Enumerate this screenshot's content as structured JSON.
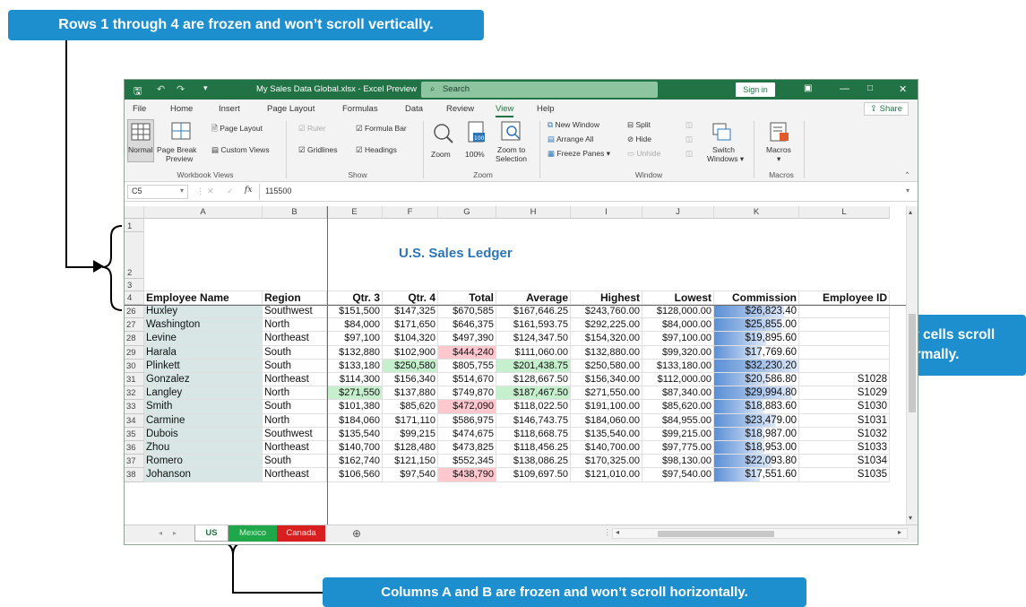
{
  "callouts": {
    "top": "Rows 1 through 4 are frozen and won’t scroll vertically.",
    "right_line1": "All other cells scroll",
    "right_line2": "normally.",
    "bottom": "Columns A and B are frozen and won’t scroll horizontally."
  },
  "titlebar": {
    "filename": "My Sales Data Global.xlsx  -  Excel Preview",
    "search_placeholder": "Search",
    "sign_in": "Sign in"
  },
  "menu": {
    "tabs": [
      "File",
      "Home",
      "Insert",
      "Page Layout",
      "Formulas",
      "Data",
      "Review",
      "View",
      "Help"
    ],
    "active": "View",
    "share": "Share"
  },
  "ribbon": {
    "workbook_views": {
      "label": "Workbook Views",
      "normal": "Normal",
      "page_break_1": "Page Break",
      "page_break_2": "Preview",
      "page_layout": "Page Layout",
      "custom_views": "Custom Views"
    },
    "show": {
      "label": "Show",
      "ruler": "Ruler",
      "formula_bar": "Formula Bar",
      "gridlines": "Gridlines",
      "headings": "Headings"
    },
    "zoom": {
      "label": "Zoom",
      "zoom": "Zoom",
      "hundred": "100%",
      "zoom_to_1": "Zoom to",
      "zoom_to_2": "Selection",
      "icon_100": "100"
    },
    "window": {
      "label": "Window",
      "new_window": "New Window",
      "arrange_all": "Arrange All",
      "freeze_panes": "Freeze Panes",
      "split": "Split",
      "hide": "Hide",
      "unhide": "Unhide",
      "switch_1": "Switch",
      "switch_2": "Windows"
    },
    "macros": {
      "label": "Macros",
      "macros": "Macros"
    }
  },
  "formula_bar": {
    "name_box": "C5",
    "fx": "fx",
    "value": "115500"
  },
  "columns": [
    "A",
    "B",
    "E",
    "F",
    "G",
    "H",
    "I",
    "J",
    "K",
    "L"
  ],
  "row_headers_frozen": [
    "1",
    "2",
    "3",
    "4"
  ],
  "title": "U.S. Sales Ledger",
  "headers": [
    "Employee Name",
    "Region",
    "Qtr. 3",
    "Qtr. 4",
    "Total",
    "Average",
    "Highest",
    "Lowest",
    "Commission",
    "Employee ID"
  ],
  "rows": [
    {
      "r": "26",
      "name": "Huxley",
      "region": "Southwest",
      "q3": "$151,500",
      "q4": "$147,325",
      "total": "$670,585",
      "avg": "$167,646.25",
      "high": "$243,760.00",
      "low": "$128,000.00",
      "comm": "$26,823.40",
      "id": ""
    },
    {
      "r": "27",
      "name": "Washington",
      "region": "North",
      "q3": "$84,000",
      "q4": "$171,650",
      "total": "$646,375",
      "avg": "$161,593.75",
      "high": "$292,225.00",
      "low": "$84,000.00",
      "comm": "$25,855.00",
      "id": ""
    },
    {
      "r": "28",
      "name": "Levine",
      "region": "Northeast",
      "q3": "$97,100",
      "q4": "$104,320",
      "total": "$497,390",
      "avg": "$124,347.50",
      "high": "$154,320.00",
      "low": "$97,100.00",
      "comm": "$19,895.60",
      "id": ""
    },
    {
      "r": "29",
      "name": "Harala",
      "region": "South",
      "q3": "$132,880",
      "q4": "$102,900",
      "total": "$444,240",
      "avg": "$111,060.00",
      "high": "$132,880.00",
      "low": "$99,320.00",
      "comm": "$17,769.60",
      "id": ""
    },
    {
      "r": "30",
      "name": "Plinkett",
      "region": "South",
      "q3": "$133,180",
      "q4": "$250,580",
      "total": "$805,755",
      "avg": "$201,438.75",
      "high": "$250,580.00",
      "low": "$133,180.00",
      "comm": "$32,230.20",
      "id": ""
    },
    {
      "r": "31",
      "name": "Gonzalez",
      "region": "Northeast",
      "q3": "$114,300",
      "q4": "$156,340",
      "total": "$514,670",
      "avg": "$128,667.50",
      "high": "$156,340.00",
      "low": "$112,000.00",
      "comm": "$20,586.80",
      "id": "S1028"
    },
    {
      "r": "32",
      "name": "Langley",
      "region": "North",
      "q3": "$271,550",
      "q4": "$137,880",
      "total": "$749,870",
      "avg": "$187,467.50",
      "high": "$271,550.00",
      "low": "$87,340.00",
      "comm": "$29,994.80",
      "id": "S1029"
    },
    {
      "r": "33",
      "name": "Smith",
      "region": "South",
      "q3": "$101,380",
      "q4": "$85,620",
      "total": "$472,090",
      "avg": "$118,022.50",
      "high": "$191,100.00",
      "low": "$85,620.00",
      "comm": "$18,883.60",
      "id": "S1030"
    },
    {
      "r": "34",
      "name": "Carmine",
      "region": "North",
      "q3": "$184,060",
      "q4": "$171,110",
      "total": "$586,975",
      "avg": "$146,743.75",
      "high": "$184,060.00",
      "low": "$84,955.00",
      "comm": "$23,479.00",
      "id": "S1031"
    },
    {
      "r": "35",
      "name": "Dubois",
      "region": "Southwest",
      "q3": "$135,540",
      "q4": "$99,215",
      "total": "$474,675",
      "avg": "$118,668.75",
      "high": "$135,540.00",
      "low": "$99,215.00",
      "comm": "$18,987.00",
      "id": "S1032"
    },
    {
      "r": "36",
      "name": "Zhou",
      "region": "Northeast",
      "q3": "$140,700",
      "q4": "$128,480",
      "total": "$473,825",
      "avg": "$118,456.25",
      "high": "$140,700.00",
      "low": "$97,775.00",
      "comm": "$18,953.00",
      "id": "S1033"
    },
    {
      "r": "37",
      "name": "Romero",
      "region": "South",
      "q3": "$162,740",
      "q4": "$121,150",
      "total": "$552,345",
      "avg": "$138,086.25",
      "high": "$170,325.00",
      "low": "$98,130.00",
      "comm": "$22,093.80",
      "id": "S1034"
    },
    {
      "r": "38",
      "name": "Johanson",
      "region": "Northeast",
      "q3": "$106,560",
      "q4": "$97,540",
      "total": "$438,790",
      "avg": "$109,697.50",
      "high": "$121,010.00",
      "low": "$97,540.00",
      "comm": "$17,551.60",
      "id": "S1035"
    }
  ],
  "sheets": [
    "US",
    "Mexico",
    "Canada"
  ],
  "colors": {
    "excel_green": "#217346",
    "callout_blue": "#1d8fcf",
    "green_fill": "#c6efce",
    "red_fill": "#ffc7ce",
    "name_fill": "#d8e6e6",
    "title_blue": "#2e75b6",
    "mexico_tab": "#1fa84a",
    "canada_tab": "#d81e1e"
  }
}
